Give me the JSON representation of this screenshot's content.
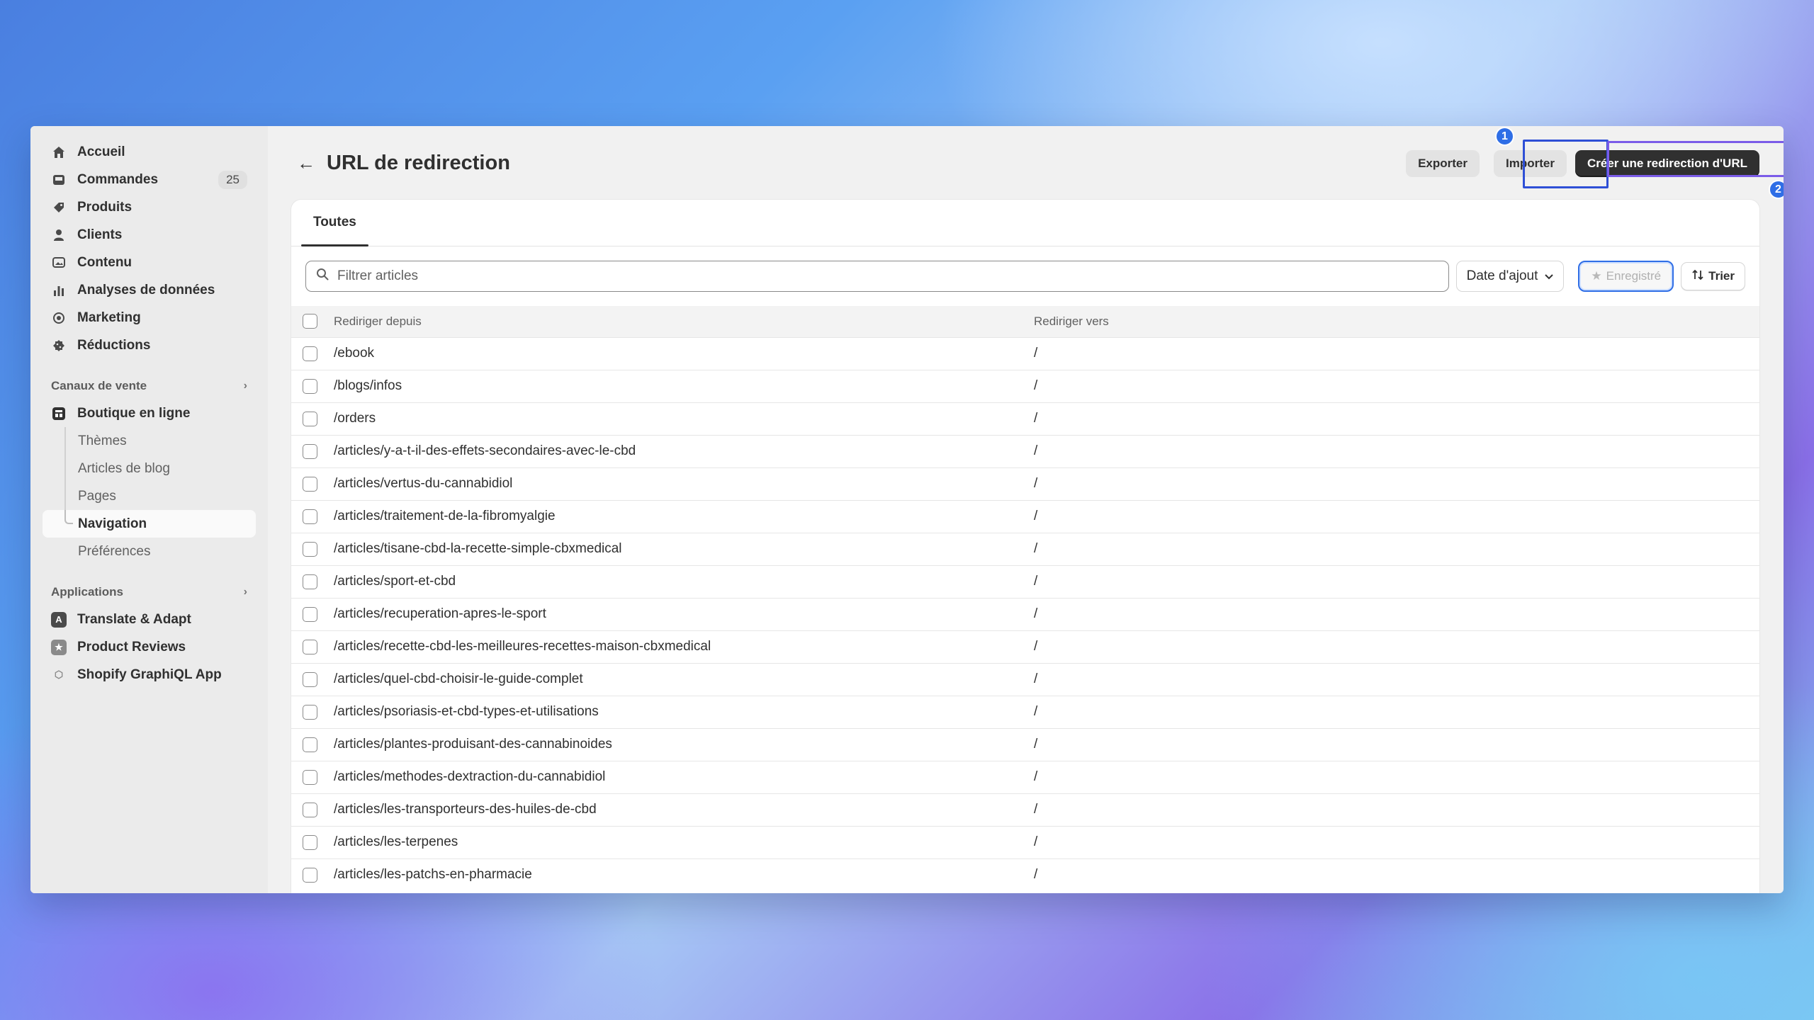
{
  "sidebar": {
    "items": [
      {
        "label": "Accueil",
        "icon": "home-icon"
      },
      {
        "label": "Commandes",
        "icon": "inbox-icon",
        "badge": "25"
      },
      {
        "label": "Produits",
        "icon": "tag-icon"
      },
      {
        "label": "Clients",
        "icon": "person-icon"
      },
      {
        "label": "Contenu",
        "icon": "image-icon"
      },
      {
        "label": "Analyses de données",
        "icon": "chart-icon"
      },
      {
        "label": "Marketing",
        "icon": "target-icon"
      },
      {
        "label": "Réductions",
        "icon": "discount-icon"
      }
    ],
    "sales_channels": {
      "heading": "Canaux de vente",
      "store": "Boutique en ligne",
      "subitems": [
        "Thèmes",
        "Articles de blog",
        "Pages",
        "Navigation",
        "Préférences"
      ],
      "active": "Navigation"
    },
    "apps": {
      "heading": "Applications",
      "items": [
        "Translate & Adapt",
        "Product Reviews",
        "Shopify GraphiQL App"
      ]
    }
  },
  "header": {
    "title": "URL de redirection",
    "export_label": "Exporter",
    "import_label": "Importer",
    "create_label": "Créer une redirection d'URL",
    "marker1": "1",
    "marker2": "2"
  },
  "tabs": [
    "Toutes"
  ],
  "filters": {
    "search_placeholder": "Filtrer articles",
    "date_label": "Date d'ajout",
    "saved_label": "Enregistré",
    "sort_label": "Trier"
  },
  "table": {
    "headers": [
      "Rediriger depuis",
      "Rediriger vers"
    ],
    "rows": [
      [
        "/ebook",
        "/"
      ],
      [
        "/blogs/infos",
        "/"
      ],
      [
        "/orders",
        "/"
      ],
      [
        "/articles/y-a-t-il-des-effets-secondaires-avec-le-cbd",
        "/"
      ],
      [
        "/articles/vertus-du-cannabidiol",
        "/"
      ],
      [
        "/articles/traitement-de-la-fibromyalgie",
        "/"
      ],
      [
        "/articles/tisane-cbd-la-recette-simple-cbxmedical",
        "/"
      ],
      [
        "/articles/sport-et-cbd",
        "/"
      ],
      [
        "/articles/recuperation-apres-le-sport",
        "/"
      ],
      [
        "/articles/recette-cbd-les-meilleures-recettes-maison-cbxmedical",
        "/"
      ],
      [
        "/articles/quel-cbd-choisir-le-guide-complet",
        "/"
      ],
      [
        "/articles/psoriasis-et-cbd-types-et-utilisations",
        "/"
      ],
      [
        "/articles/plantes-produisant-des-cannabinoides",
        "/"
      ],
      [
        "/articles/methodes-dextraction-du-cannabidiol",
        "/"
      ],
      [
        "/articles/les-transporteurs-des-huiles-de-cbd",
        "/"
      ],
      [
        "/articles/les-terpenes",
        "/"
      ],
      [
        "/articles/les-patchs-en-pharmacie",
        "/"
      ]
    ]
  }
}
